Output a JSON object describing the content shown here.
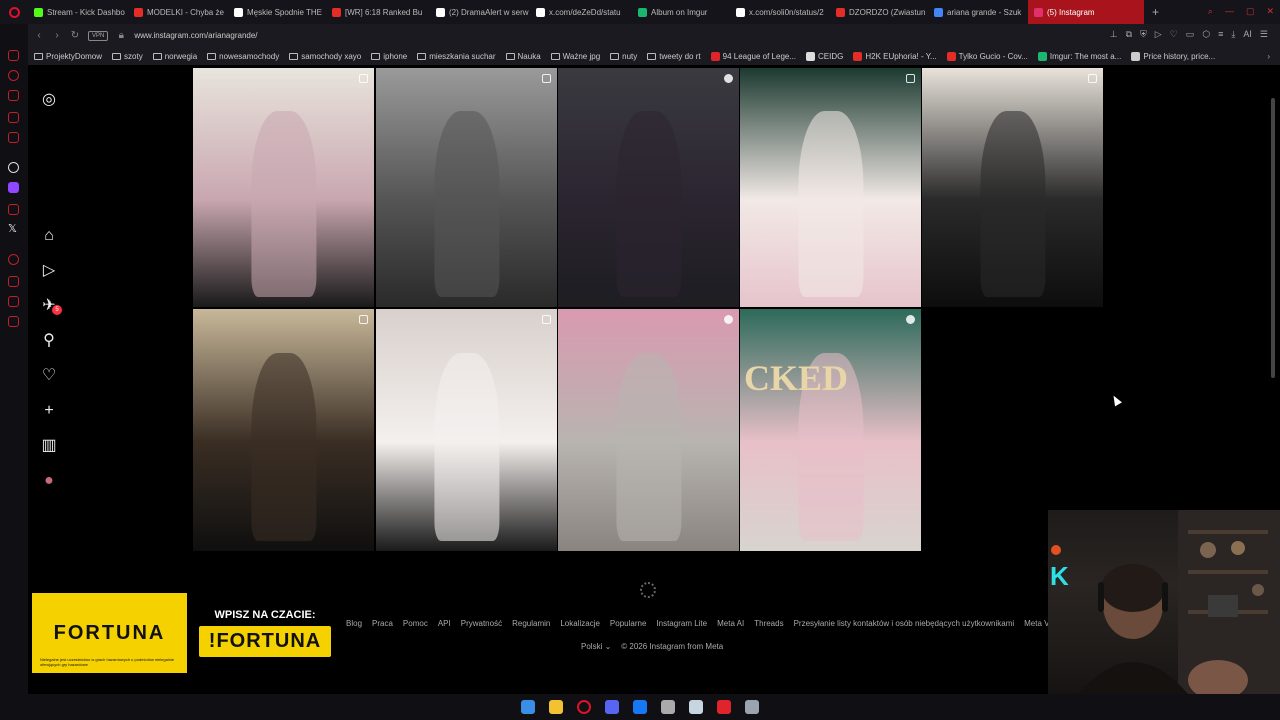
{
  "browser": {
    "tabs": [
      {
        "label": "Stream - Kick Dashbo",
        "color": "#53fc18"
      },
      {
        "label": "MODELKI - Chyba że",
        "color": "#e52d27"
      },
      {
        "label": "Męskie Spodnie THE",
        "color": "#ffffff"
      },
      {
        "label": "[WR] 6:18 Ranked Bu",
        "color": "#e52d27"
      },
      {
        "label": "(2) DramaAlert w serw",
        "color": "#ffffff"
      },
      {
        "label": "x.com/deZeDd/statu",
        "color": "#ffffff"
      },
      {
        "label": "Album on Imgur",
        "color": "#1bb76e"
      },
      {
        "label": "x.com/soli0n/status/2",
        "color": "#ffffff"
      },
      {
        "label": "DZORDZO (Zwiastun",
        "color": "#e52d27"
      },
      {
        "label": "ariana grande - Szuk",
        "color": "#4285f4"
      },
      {
        "label": "(5) Instagram",
        "color": "#e1306c",
        "active": true
      }
    ],
    "new_tab_label": "+",
    "url": "www.instagram.com/arianagrande/",
    "vpn_label": "VPN",
    "ai_label": "AI",
    "bookmarks": [
      {
        "label": "ProjektyDomow",
        "icon": "folder-icon"
      },
      {
        "label": "szoty",
        "icon": "folder-icon"
      },
      {
        "label": "norwegia",
        "icon": "folder-icon"
      },
      {
        "label": "nowesamochody",
        "icon": "folder-icon"
      },
      {
        "label": "samochody xayo",
        "icon": "folder-icon"
      },
      {
        "label": "iphone",
        "icon": "folder-icon"
      },
      {
        "label": "mieszkania suchar",
        "icon": "folder-icon"
      },
      {
        "label": "Nauka",
        "icon": "folder-icon"
      },
      {
        "label": "Ważne jpg",
        "icon": "folder-icon"
      },
      {
        "label": "nuty",
        "icon": "folder-icon"
      },
      {
        "label": "tweety do rt",
        "icon": "folder-icon"
      },
      {
        "label": "94 League of Lege...",
        "icon": "site-icon",
        "color": "#e0242b"
      },
      {
        "label": "CEIDG",
        "icon": "site-icon",
        "color": "#dddddd"
      },
      {
        "label": "H2K EUphoria! - Y...",
        "icon": "site-icon",
        "color": "#e52d27"
      },
      {
        "label": "Tylko Gucio - Cov...",
        "icon": "site-icon",
        "color": "#e52d27"
      },
      {
        "label": "Imgur: The most a...",
        "icon": "site-icon",
        "color": "#1bb76e"
      },
      {
        "label": "Price history, price...",
        "icon": "page-icon",
        "color": "#cccccc"
      }
    ]
  },
  "instagram": {
    "nav": [
      {
        "name": "instagram-logo-icon",
        "glyph": "◎"
      },
      {
        "name": "home-icon",
        "glyph": "⌂"
      },
      {
        "name": "reels-icon",
        "glyph": "▷"
      },
      {
        "name": "messages-icon",
        "glyph": "✈",
        "badge": "5"
      },
      {
        "name": "search-icon",
        "glyph": "⚲"
      },
      {
        "name": "notifications-heart-icon",
        "glyph": "♡"
      },
      {
        "name": "create-icon",
        "glyph": "+"
      },
      {
        "name": "dashboard-icon",
        "glyph": "▥"
      },
      {
        "name": "profile-avatar-icon",
        "glyph": "●"
      }
    ],
    "posts": [
      {
        "label": "Pink sequin dress in hotel hallway",
        "indicator": "carousel",
        "colors": [
          "#e8e4dc",
          "#c9a7b0",
          "#1a1a1a"
        ]
      },
      {
        "label": "Black and white sparkly gown",
        "indicator": "carousel",
        "colors": [
          "#9a9a9a",
          "#555555",
          "#2a2a2a"
        ]
      },
      {
        "label": "Dark scene with two figures",
        "indicator": "reel",
        "colors": [
          "#3a3a40",
          "#2b2530",
          "#1d1d22"
        ]
      },
      {
        "label": "White fur coat portrait",
        "indicator": "carousel",
        "colors": [
          "#1c3a30",
          "#f2e9e6",
          "#e6c4cc"
        ]
      },
      {
        "label": "Black ball gown",
        "indicator": "carousel",
        "colors": [
          "#e8e2da",
          "#2a2a2a",
          "#0d0d0d"
        ]
      },
      {
        "label": "Black gown on staircase",
        "indicator": "carousel",
        "colors": [
          "#c8b89a",
          "#3a2e24",
          "#0f0f0f"
        ]
      },
      {
        "label": "White dress with friend in black",
        "indicator": "carousel",
        "colors": [
          "#d8d0cc",
          "#f4f0ee",
          "#1a1a1a"
        ]
      },
      {
        "label": "Gown on flower staircase",
        "indicator": "reel",
        "colors": [
          "#d99ab0",
          "#b8b4b0",
          "#8a8480"
        ]
      },
      {
        "label": "Wicked premiere staircase",
        "indicator": "reel",
        "colors": [
          "#2d6a5a",
          "#e8c0c8",
          "#d8d4d0"
        ],
        "caption": "CKED"
      }
    ],
    "footer_links": [
      "Blog",
      "Praca",
      "Pomoc",
      "API",
      "Prywatność",
      "Regulamin",
      "Lokalizacje",
      "Popularne",
      "Instagram Lite",
      "Meta AI",
      "Threads",
      "Przesyłanie listy kontaktów i osób niebędących użytkownikami",
      "Meta Verified"
    ],
    "language": "Polski",
    "copyright": "© 2026 Instagram from Meta"
  },
  "overlay": {
    "brand": "FORTUNA",
    "cta": "WPISZ NA CZACIE:",
    "command": "!FORTUNA",
    "fine_print": "Nielegalne jest uczestnictwo w grach hazardowych u podmiotów nielegalnie oferujących gry hazardowe"
  },
  "taskbar": [
    {
      "name": "windows-start-icon",
      "color": "#3a8ee6"
    },
    {
      "name": "file-explorer-icon",
      "color": "#f2c233"
    },
    {
      "name": "opera-gx-icon",
      "color": "#e0112b"
    },
    {
      "name": "discord-icon",
      "color": "#5865f2"
    },
    {
      "name": "messenger-icon",
      "color": "#1877f2"
    },
    {
      "name": "chrome-icon",
      "color": "#aaaaaa"
    },
    {
      "name": "steam-icon",
      "color": "#c7d5e0"
    },
    {
      "name": "riot-client-icon",
      "color": "#e0242b"
    },
    {
      "name": "settings-icon",
      "color": "#9aa4b0"
    }
  ]
}
